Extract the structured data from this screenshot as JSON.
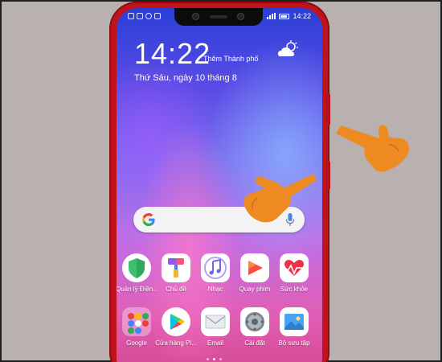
{
  "status_bar": {
    "time": "14:22"
  },
  "lock": {
    "clock": "14:22",
    "city_label": "Thêm Thành phố",
    "date": "Thứ Sáu, ngày 10 tháng 8",
    "weather_icon": "cloud-sun-icon"
  },
  "search": {
    "logo_icon": "google-g-icon",
    "mic_icon": "mic-icon"
  },
  "apps_row1": [
    {
      "label": "Quản lý Điện...",
      "icon": "shield-icon"
    },
    {
      "label": "Chủ đề",
      "icon": "paint-roller-icon"
    },
    {
      "label": "Nhạc",
      "icon": "music-note-icon"
    },
    {
      "label": "Quay phim",
      "icon": "video-play-icon"
    },
    {
      "label": "Sức khỏe",
      "icon": "heart-pulse-icon"
    }
  ],
  "apps_row2": [
    {
      "label": "Google",
      "icon": "google-folder-icon"
    },
    {
      "label": "Cửa hàng Pl...",
      "icon": "play-store-icon"
    },
    {
      "label": "Email",
      "icon": "mail-icon"
    },
    {
      "label": "Cài đặt",
      "icon": "settings-gear-icon"
    },
    {
      "label": "Bộ sưu tập",
      "icon": "gallery-icon"
    }
  ],
  "colors": {
    "phone_frame": "#c0141c",
    "hand_pointer": "#ee8a22",
    "background": "#b9b1b0"
  }
}
